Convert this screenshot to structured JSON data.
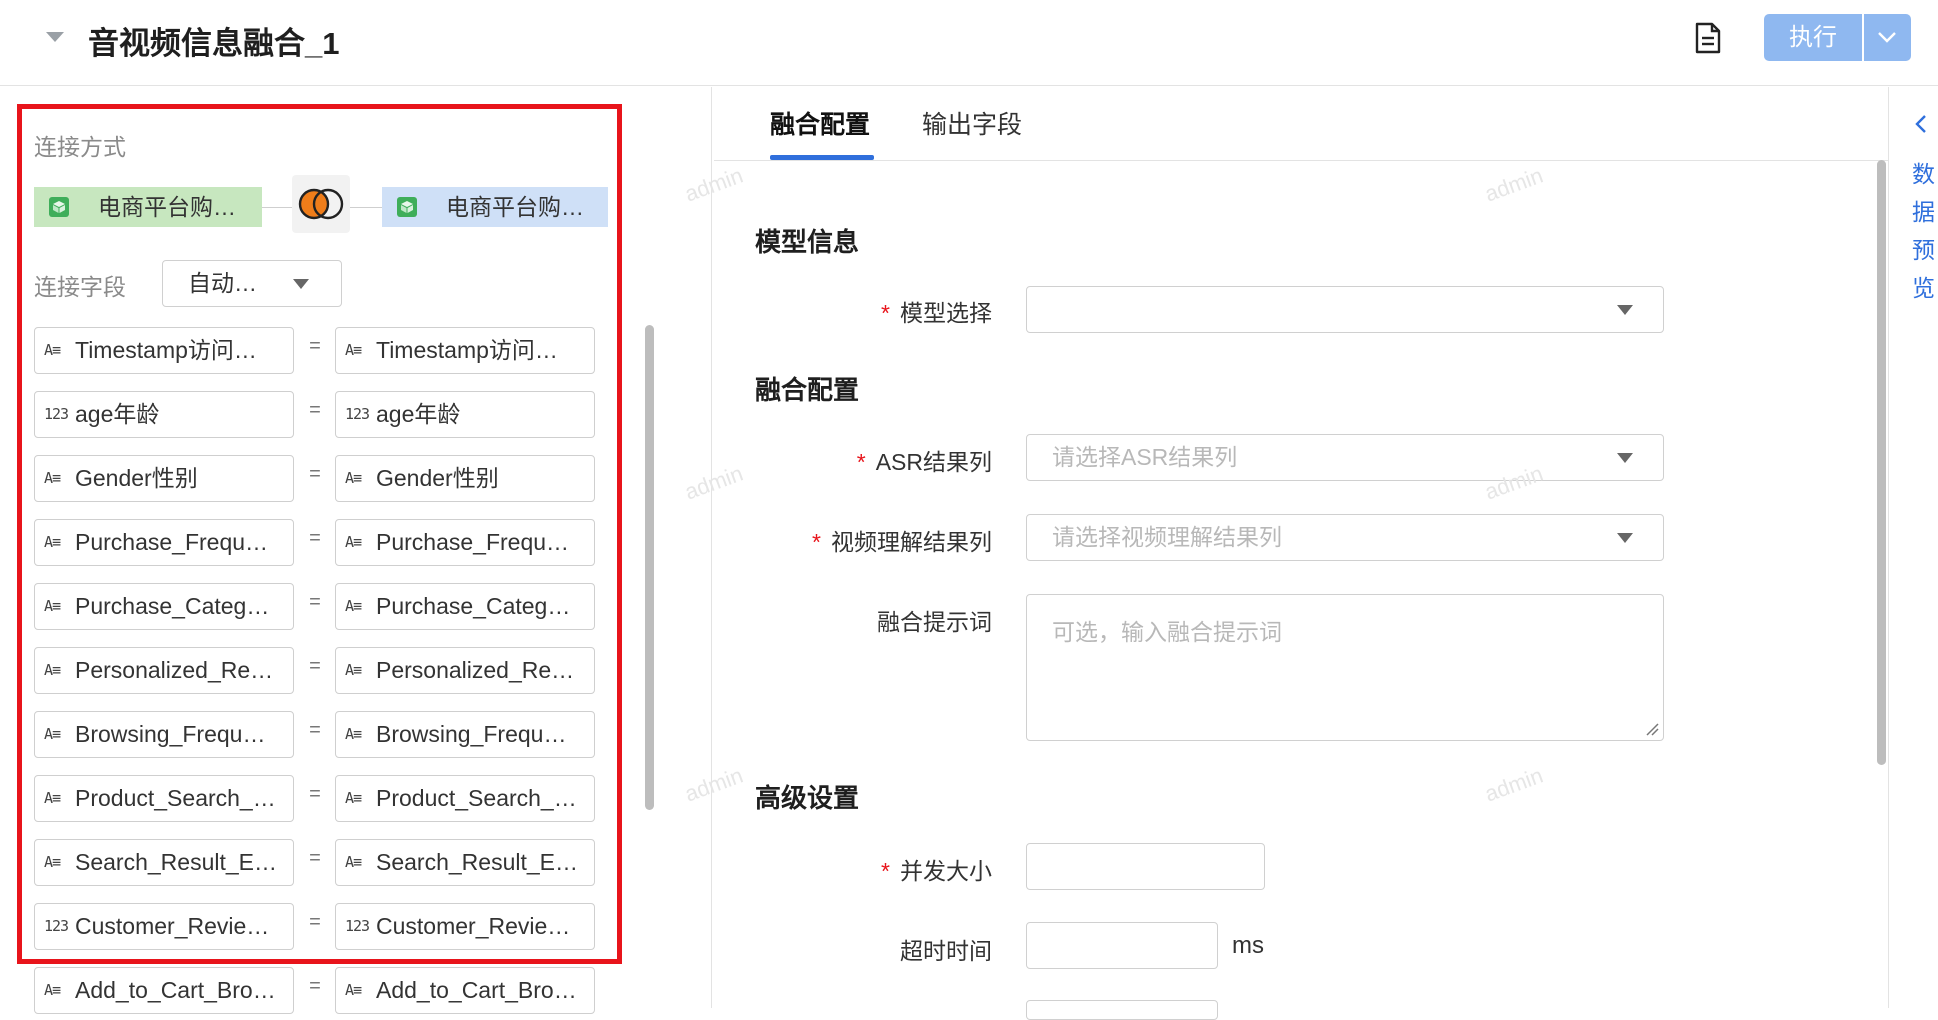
{
  "header": {
    "title": "音视频信息融合_1",
    "run_label": "执行"
  },
  "left": {
    "join_label": "连接方式",
    "left_table": "电商平台购…",
    "right_table": "电商平台购…",
    "join_field_label": "连接字段",
    "join_field_value": "自动…",
    "field_pairs": [
      {
        "type": "A≡",
        "left": "Timestamp访问…",
        "right": "Timestamp访问…"
      },
      {
        "type": "123",
        "left": "age年龄",
        "right": "age年龄"
      },
      {
        "type": "A≡",
        "left": "Gender性别",
        "right": "Gender性别"
      },
      {
        "type": "A≡",
        "left": "Purchase_Frequ…",
        "right": "Purchase_Frequ…"
      },
      {
        "type": "A≡",
        "left": "Purchase_Categ…",
        "right": "Purchase_Categ…"
      },
      {
        "type": "A≡",
        "left": "Personalized_Re…",
        "right": "Personalized_Re…"
      },
      {
        "type": "A≡",
        "left": "Browsing_Frequ…",
        "right": "Browsing_Frequ…"
      },
      {
        "type": "A≡",
        "left": "Product_Search_…",
        "right": "Product_Search_…"
      },
      {
        "type": "A≡",
        "left": "Search_Result_E…",
        "right": "Search_Result_E…"
      },
      {
        "type": "123",
        "left": "Customer_Revie…",
        "right": "Customer_Revie…"
      },
      {
        "type": "A≡",
        "left": "Add_to_Cart_Bro…",
        "right": "Add_to_Cart_Bro…"
      }
    ],
    "eq": "="
  },
  "tabs": [
    "融合配置",
    "输出字段"
  ],
  "form": {
    "model_section": "模型信息",
    "model_label": "模型选择",
    "fusion_section": "融合配置",
    "asr_label": "ASR结果列",
    "asr_placeholder": "请选择ASR结果列",
    "video_label": "视频理解结果列",
    "video_placeholder": "请选择视频理解结果列",
    "prompt_label": "融合提示词",
    "prompt_placeholder": "可选，输入融合提示词",
    "advanced_section": "高级设置",
    "concurrency_label": "并发大小",
    "timeout_label": "超时时间",
    "timeout_unit": "ms",
    "required_mark": "*"
  },
  "side": {
    "preview_label": "数据预览"
  },
  "watermark": "admin",
  "colors": {
    "primary": "#2f6fdc",
    "run_button": "#8fb8f0",
    "highlight": "#e8141b",
    "left_table_bg": "#c7e7bf",
    "right_table_bg": "#cfe0f7",
    "join_orange": "#ef7d1a"
  }
}
